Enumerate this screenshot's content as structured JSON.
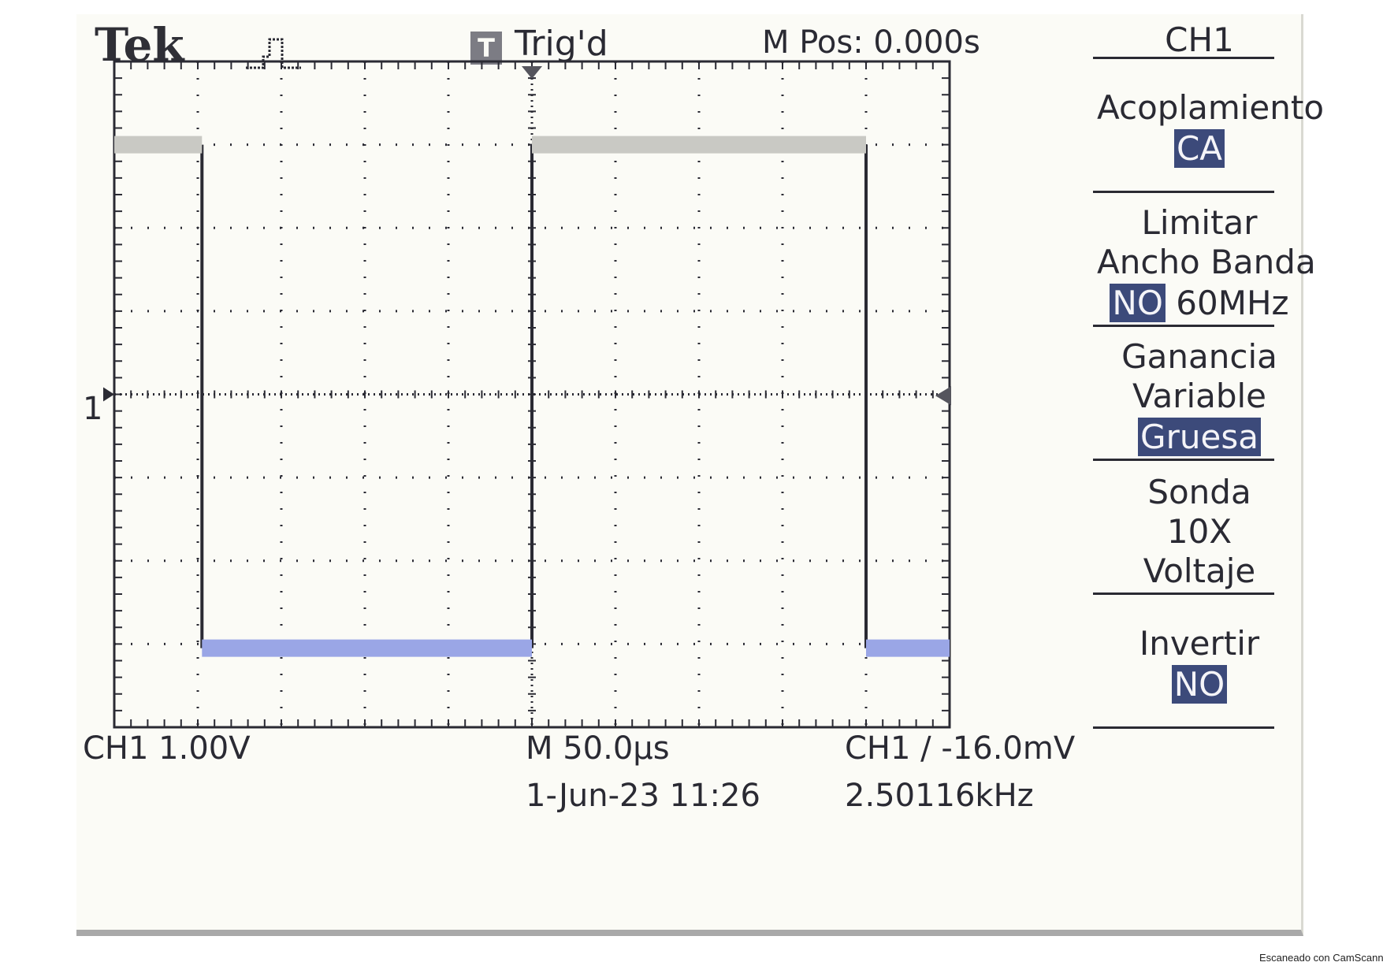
{
  "header": {
    "brand": "Tek",
    "trigger_icon": "T",
    "trigger_status": "Trig'd",
    "horizontal_position": "M Pos: 0.000s"
  },
  "channel_marker": "1",
  "side_menu": {
    "title": "CH1",
    "coupling": {
      "label": "Acoplamiento",
      "value": "CA"
    },
    "bandwidth": {
      "label_line1": "Limitar",
      "label_line2": "Ancho Banda",
      "value": "NO",
      "suffix": "60MHz"
    },
    "gain": {
      "label_line1": "Ganancia",
      "label_line2": "Variable",
      "value": "Gruesa"
    },
    "probe": {
      "label": "Sonda",
      "value_line1": "10X",
      "value_line2": "Voltaje"
    },
    "invert": {
      "label": "Invertir",
      "value": "NO"
    }
  },
  "status_bar": {
    "ch_scale": "CH1  1.00V",
    "timebase": "M 50.0µs",
    "trigger_level": "CH1 ∕ -16.0mV",
    "datetime": "1-Jun-23 11:26",
    "frequency": "2.50116kHz"
  },
  "footer_credit": "Escaneado con CamScanner",
  "colors": {
    "trace_high": "#c9c9c4",
    "trace_low": "#9aa6e6",
    "grid": "#2a2a33",
    "screen_bg": "#fbfbf6",
    "highlight": "#3c4a7a"
  },
  "chart_data": {
    "type": "line",
    "description_units": {
      "x": "divisions",
      "y": "volts"
    },
    "x_range": [
      0,
      10
    ],
    "y_range": [
      -4,
      4
    ],
    "volts_per_div": 1.0,
    "time_per_div_us": 50.0,
    "trigger_level_mV": -16.0,
    "frequency_kHz": 2.50116,
    "series": [
      {
        "waveform": "square",
        "points": [
          [
            0.0,
            3.0
          ],
          [
            1.05,
            3.0
          ],
          [
            1.05,
            -3.05
          ],
          [
            5.0,
            -3.05
          ],
          [
            5.0,
            3.0
          ],
          [
            9.0,
            3.0
          ],
          [
            9.0,
            -3.05
          ],
          [
            10.0,
            -3.05
          ]
        ]
      }
    ]
  }
}
